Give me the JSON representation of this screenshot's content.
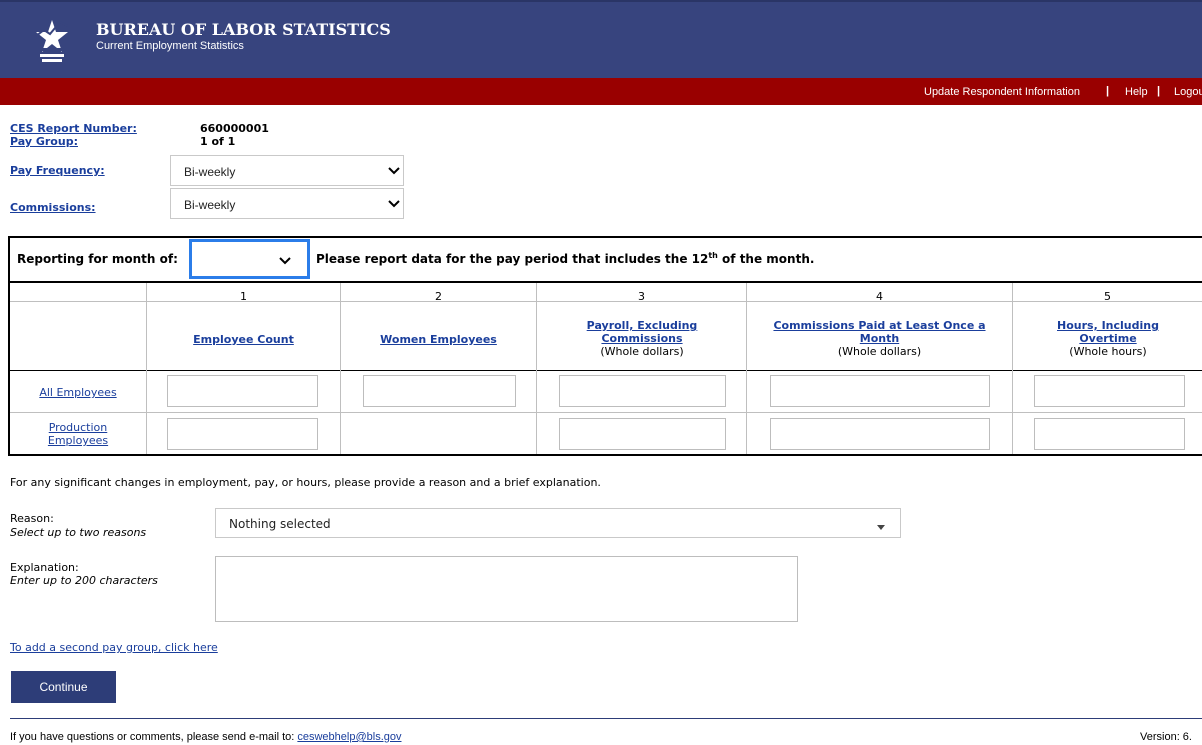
{
  "header": {
    "agency": "BUREAU OF LABOR STATISTICS",
    "program": "Current Employment Statistics",
    "brand_color": "#37447e",
    "bar_color": "#990000"
  },
  "top_links": {
    "update": "Update Respondent Information",
    "help": "Help",
    "logout": "Logout",
    "separator": "|"
  },
  "report_info": {
    "report_number_label": "CES Report Number:",
    "report_number_value": "660000001",
    "pay_group_label": "Pay Group:",
    "pay_group_value": "1 of 1",
    "pay_frequency_label": "Pay Frequency:",
    "pay_frequency_value": "Bi-weekly",
    "commissions_label": "Commissions:",
    "commissions_value": "Bi-weekly"
  },
  "reporting": {
    "label": "Reporting for month of:",
    "month_value": "",
    "instruction_prefix": "Please report data for the pay period that includes the 12",
    "instruction_sup": "th",
    "instruction_suffix": " of the month."
  },
  "columns": [
    {
      "num": "1",
      "title": "Employee Count",
      "sub": ""
    },
    {
      "num": "2",
      "title": "Women Employees",
      "sub": ""
    },
    {
      "num": "3",
      "title": "Payroll, Excluding Commissions",
      "sub": "(Whole dollars)"
    },
    {
      "num": "4",
      "title": "Commissions Paid at Least Once a Month",
      "sub": "(Whole dollars)"
    },
    {
      "num": "5",
      "title": "Hours, Including Overtime",
      "sub": "(Whole hours)"
    }
  ],
  "rows": [
    {
      "label": "All Employees"
    },
    {
      "label": "Production Employees"
    }
  ],
  "changes": {
    "intro": "For any significant changes in employment, pay, or hours, please provide a reason and a brief explanation.",
    "reason_label": "Reason:",
    "reason_hint": "Select up to two reasons",
    "reason_value": "Nothing selected",
    "explanation_label": "Explanation:",
    "explanation_hint": "Enter up to 200 characters",
    "explanation_value": ""
  },
  "add_pay_group": "To add a second pay group, click here",
  "continue_label": "Continue",
  "footer": {
    "text": "If you have questions or comments, please send e-mail to: ",
    "email": "ceswebhelp@bls.gov",
    "version": "Version: 6."
  }
}
